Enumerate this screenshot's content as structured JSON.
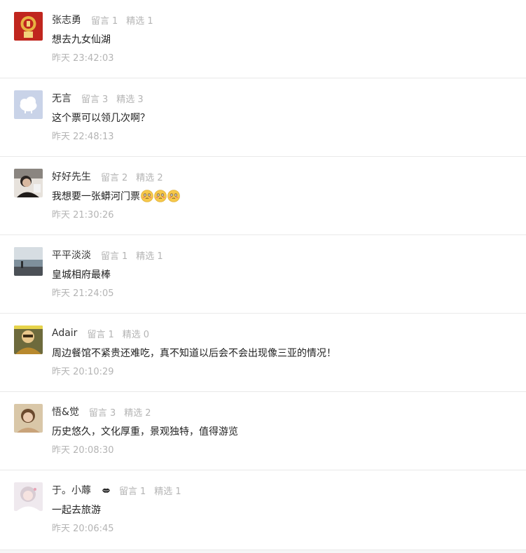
{
  "labels": {
    "message_label": "留言",
    "selected_label": "精选"
  },
  "comments": [
    {
      "name": "张志勇",
      "messages": "1",
      "selected": "1",
      "text": "想去九女仙湖",
      "time": "昨天 23:42:03",
      "avatar_icon": "red-fortune-avatar-icon"
    },
    {
      "name": "无言",
      "messages": "3",
      "selected": "3",
      "text": "这个票可以领几次啊？",
      "time": "昨天 22:48:13",
      "avatar_icon": "cloud-avatar-icon"
    },
    {
      "name": "好好先生",
      "messages": "2",
      "selected": "2",
      "text": "我想要一张蟒河门票",
      "emojis": 3,
      "time": "昨天 21:30:26",
      "avatar_icon": "person-avatar-icon"
    },
    {
      "name": "平平淡淡",
      "messages": "1",
      "selected": "1",
      "text": "皇城相府最棒",
      "time": "昨天 21:24:05",
      "avatar_icon": "seascape-avatar-icon"
    },
    {
      "name": "Adair",
      "messages": "1",
      "selected": "0",
      "text": "周边餐馆不紧贵还难吃，真不知道以后会不会出现像三亚的情况！",
      "time": "昨天 20:10:29",
      "avatar_icon": "portrait-avatar-icon"
    },
    {
      "name": "悟&觉",
      "messages": "3",
      "selected": "2",
      "text": "历史悠久，文化厚重，景观独特，值得游览",
      "time": "昨天 20:08:30",
      "avatar_icon": "woman-avatar-icon"
    },
    {
      "name": "于。小蓐",
      "messages": "1",
      "selected": "1",
      "text": "一起去旅游",
      "time": "昨天 20:06:45",
      "avatar_icon": "girl-avatar-icon"
    }
  ]
}
